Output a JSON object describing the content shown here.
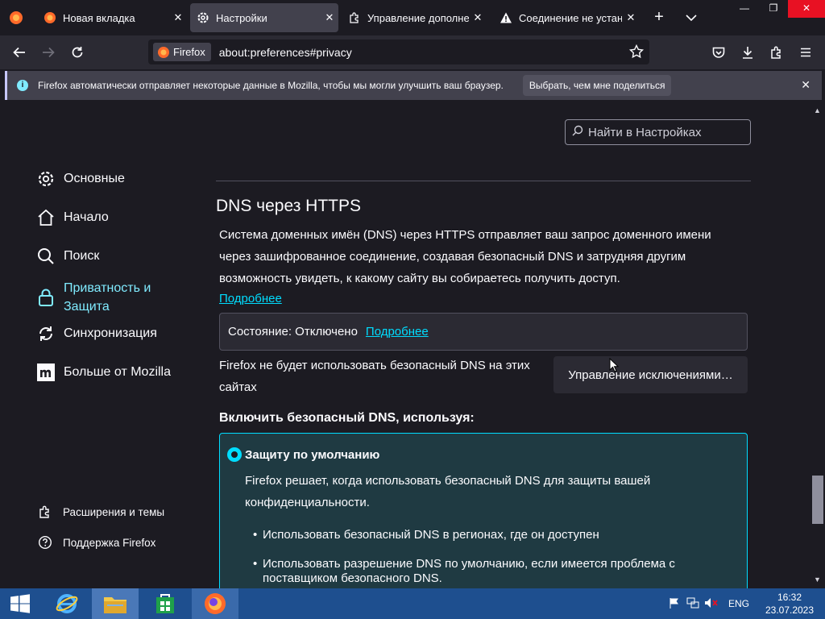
{
  "tabs": [
    {
      "label": "Новая вкладка",
      "icon": "firefox-icon"
    },
    {
      "label": "Настройки",
      "icon": "gear-icon",
      "active": true
    },
    {
      "label": "Управление дополнени",
      "icon": "puzzle-icon"
    },
    {
      "label": "Соединение не устано",
      "icon": "warning-icon"
    }
  ],
  "tab_close_glyph": "✕",
  "new_tab_glyph": "+",
  "window_controls": {
    "minimize": "—",
    "restore": "❐",
    "close": "✕"
  },
  "urlbar": {
    "identity_label": "Firefox",
    "url": "about:preferences#privacy"
  },
  "notification": {
    "icon_glyph": "i",
    "text": "Firefox автоматически отправляет некоторые данные в Mozilla, чтобы мы могли улучшить ваш браузер.",
    "button": "Выбрать, чем мне поделиться",
    "close_glyph": "✕"
  },
  "search": {
    "placeholder": "Найти в Настройках"
  },
  "sidebar": {
    "items": [
      {
        "label": "Основные",
        "icon": "gear-icon"
      },
      {
        "label": "Начало",
        "icon": "home-icon"
      },
      {
        "label": "Поиск",
        "icon": "search-icon"
      },
      {
        "label": "Приватность и Защита",
        "icon": "lock-icon",
        "active": true
      },
      {
        "label": "Синхронизация",
        "icon": "sync-icon"
      },
      {
        "label": "Больше от Mozilla",
        "icon": "mozilla-icon"
      }
    ],
    "footer": [
      {
        "label": "Расширения и темы",
        "icon": "puzzle-icon"
      },
      {
        "label": "Поддержка Firefox",
        "icon": "help-icon"
      }
    ]
  },
  "dns": {
    "title": "DNS через HTTPS",
    "description": "Система доменных имён (DNS) через HTTPS отправляет ваш запрос доменного имени через зашифрованное соединение, создавая безопасный DNS и затрудняя другим возможность увидеть, к какому сайту вы собираетесь получить доступ.",
    "learn_more": "Подробнее",
    "status": "Состояние: Отключено",
    "status_learn_more": "Подробнее",
    "exceptions_text": "Firefox не будет использовать безопасный DNS на этих сайтах",
    "exceptions_button": "Управление исключениями…",
    "enable_heading": "Включить безопасный DNS, используя:",
    "option_label": "Защиту по умолчанию",
    "option_desc": "Firefox решает, когда использовать безопасный DNS для защиты вашей конфиденциальности.",
    "bullets": [
      "Использовать безопасный DNS в регионах, где он доступен",
      "Использовать разрешение DNS по умолчанию, если имеется проблема с поставщиком безопасного DNS."
    ]
  },
  "taskbar": {
    "language": "ENG",
    "time": "16:32",
    "date": "23.07.2023"
  },
  "colors": {
    "accent": "#00ddff",
    "background": "#1c1b22",
    "taskbar": "#1e4f8f"
  }
}
